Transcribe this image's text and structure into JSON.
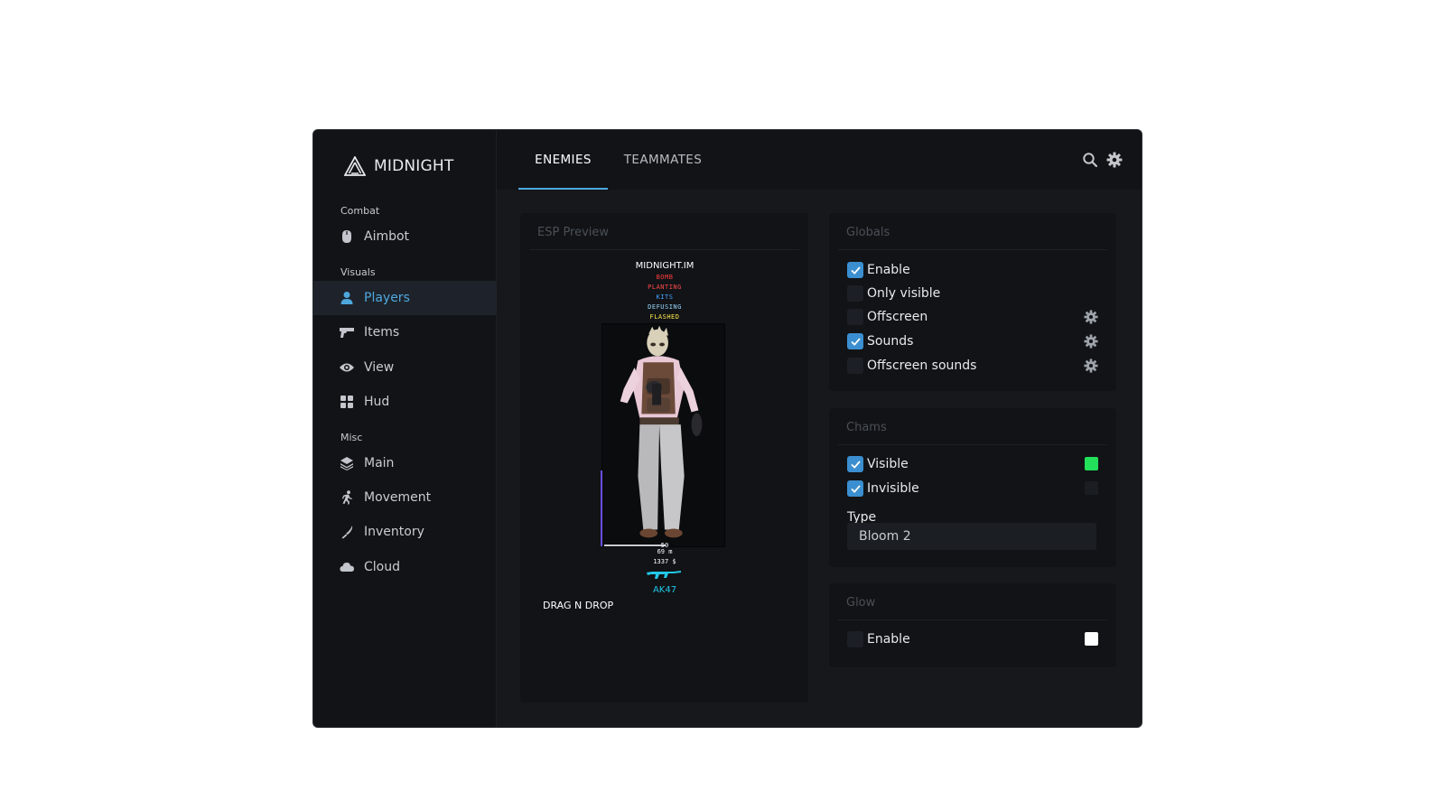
{
  "app": {
    "brand": "MIDNIGHT"
  },
  "sidebar": {
    "sections": [
      {
        "label": "Combat"
      },
      {
        "label": "Visuals"
      },
      {
        "label": "Misc"
      }
    ],
    "items": [
      {
        "label": "Aimbot",
        "icon": "mouse-icon"
      },
      {
        "label": "Players",
        "icon": "person-icon",
        "active": true
      },
      {
        "label": "Items",
        "icon": "gun-icon"
      },
      {
        "label": "View",
        "icon": "eye-icon"
      },
      {
        "label": "Hud",
        "icon": "grid-icon"
      },
      {
        "label": "Main",
        "icon": "layers-icon"
      },
      {
        "label": "Movement",
        "icon": "running-icon"
      },
      {
        "label": "Inventory",
        "icon": "knife-icon"
      },
      {
        "label": "Cloud",
        "icon": "cloud-icon"
      }
    ]
  },
  "tabs": [
    {
      "label": "ENEMIES",
      "active": true
    },
    {
      "label": "TEAMMATES",
      "active": false
    }
  ],
  "esp_preview": {
    "title": "ESP Preview",
    "player_name": "MIDNIGHT.IM",
    "flags": [
      {
        "text": "BOMB",
        "color": "#ff3b3b"
      },
      {
        "text": "PLANTING",
        "color": "#ff4a4a"
      },
      {
        "text": "KITS",
        "color": "#4aa3ff"
      },
      {
        "text": "DEFUSING",
        "color": "#9ad7ff"
      },
      {
        "text": "FLASHED",
        "color": "#ffe84a"
      }
    ],
    "health": "50",
    "distance": "69 m",
    "money": "1337 $",
    "weapon": "AK47",
    "drag_label": "DRAG N DROP"
  },
  "globals": {
    "title": "Globals",
    "options": [
      {
        "label": "Enable",
        "checked": true,
        "settings": false
      },
      {
        "label": "Only visible",
        "checked": false,
        "settings": false
      },
      {
        "label": "Offscreen",
        "checked": false,
        "settings": true
      },
      {
        "label": "Sounds",
        "checked": true,
        "settings": true
      },
      {
        "label": "Offscreen sounds",
        "checked": false,
        "settings": true
      }
    ]
  },
  "chams": {
    "title": "Chams",
    "options": [
      {
        "label": "Visible",
        "checked": true,
        "color": "#22e05a"
      },
      {
        "label": "Invisible",
        "checked": true,
        "color": "#1a1d22"
      }
    ],
    "type_label": "Type",
    "type_value": "Bloom 2"
  },
  "glow": {
    "title": "Glow",
    "options": [
      {
        "label": "Enable",
        "checked": false,
        "color": "#ffffff"
      }
    ]
  },
  "colors": {
    "accent": "#4ea8de",
    "background": "#16181c",
    "panel": "#111316"
  }
}
